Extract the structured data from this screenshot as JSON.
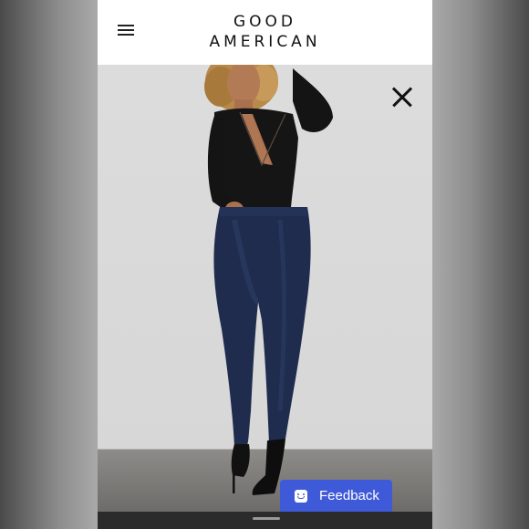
{
  "header": {
    "brand_line1": "GOOD",
    "brand_line2": "AMERICAN",
    "menu_icon": "hamburger-menu-icon"
  },
  "hero": {
    "close_icon": "close-icon"
  },
  "feedback": {
    "label": "Feedback",
    "icon": "smiley-face-icon",
    "color": "#3f5ad8"
  }
}
